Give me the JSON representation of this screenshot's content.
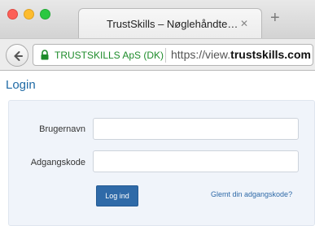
{
  "browser": {
    "tab_title": "TrustSkills – Nøglehåndte…",
    "tab_close": "✕",
    "new_tab": "+",
    "ev_certificate_name": "TRUSTSKILLS ApS (DK)",
    "url_prefix": "https://view.",
    "url_domain": "trustskills.com"
  },
  "page": {
    "title": "Login",
    "username_label": "Brugernavn",
    "username_value": "",
    "password_label": "Adgangskode",
    "password_value": "",
    "login_button": "Log ind",
    "forgot_password_link": "Glemt din adgangskode?"
  },
  "colors": {
    "accent": "#2f6aa8",
    "ev_green": "#1d8b2a",
    "panel_background": "#f0f4fa"
  },
  "icons": {
    "traffic_lights": [
      "close-window-icon",
      "minimize-window-icon",
      "zoom-window-icon"
    ],
    "back": "back-arrow-icon",
    "lock": "lock-icon"
  }
}
